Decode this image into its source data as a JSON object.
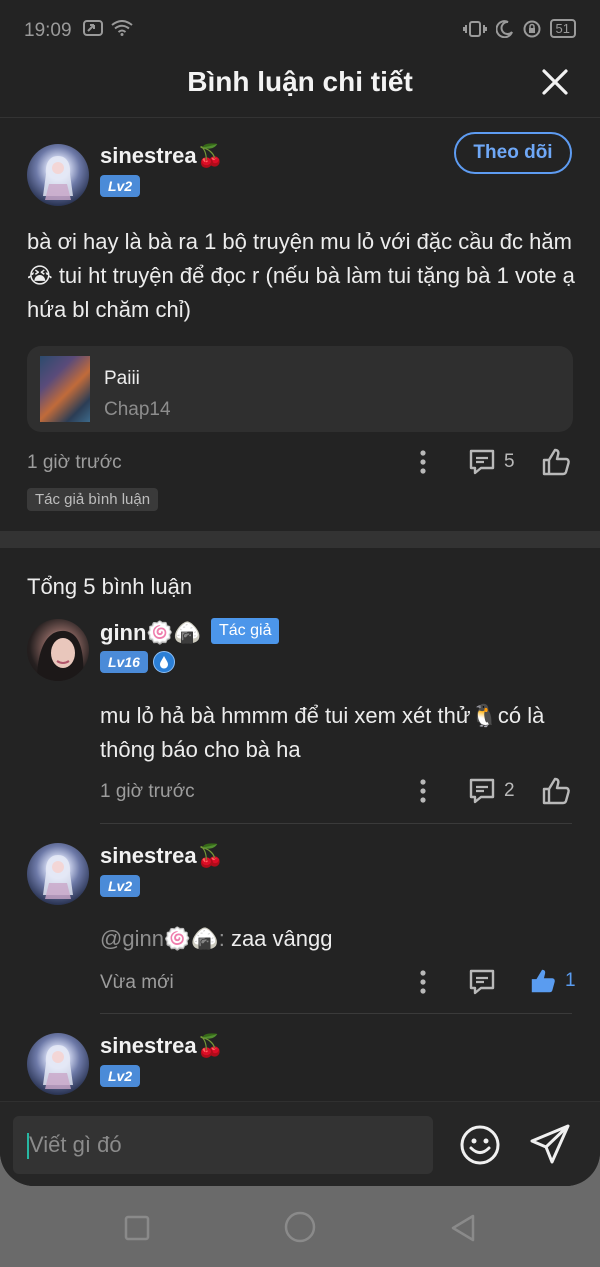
{
  "status_bar": {
    "time": "19:09",
    "battery": "51"
  },
  "header": {
    "title": "Bình luận chi tiết"
  },
  "post": {
    "username": "sinestrea🍒",
    "level": "Lv2",
    "follow_label": "Theo dõi",
    "text": "bà ơi hay là bà ra 1 bộ truyện mu lỏ với đặc cầu đc hăm 😭 tui ht truyện để đọc r (nếu bà làm tui tặng bà 1 vote ạ hứa bl chăm chỉ)",
    "chapter": {
      "title": "Paiii",
      "subtitle": "Chap14"
    },
    "time": "1 giờ trước",
    "reply_count": "5",
    "tag": "Tác giả bình luận"
  },
  "comments_section": {
    "total_label": "Tổng 5 bình luận",
    "comments": [
      {
        "username": "ginn🍥🍙",
        "badge": "Tác giả",
        "level": "Lv16",
        "text": "mu lỏ hả bà hmmm để tui xem xét thử🐧có là thông báo cho bà ha",
        "time": "1 giờ trước",
        "reply_count": "2"
      },
      {
        "username": "sinestrea🍒",
        "level": "Lv2",
        "mention": "@ginn🍥🍙:",
        "text": " zaa vângg",
        "time": "Vừa mới",
        "like_count": "1"
      },
      {
        "username": "sinestrea🍒",
        "level": "Lv2"
      }
    ]
  },
  "input": {
    "placeholder": "Viết gì đó"
  },
  "colors": {
    "background": "#232323",
    "accent": "#4b8bd8",
    "follow": "#6fa8f7"
  }
}
